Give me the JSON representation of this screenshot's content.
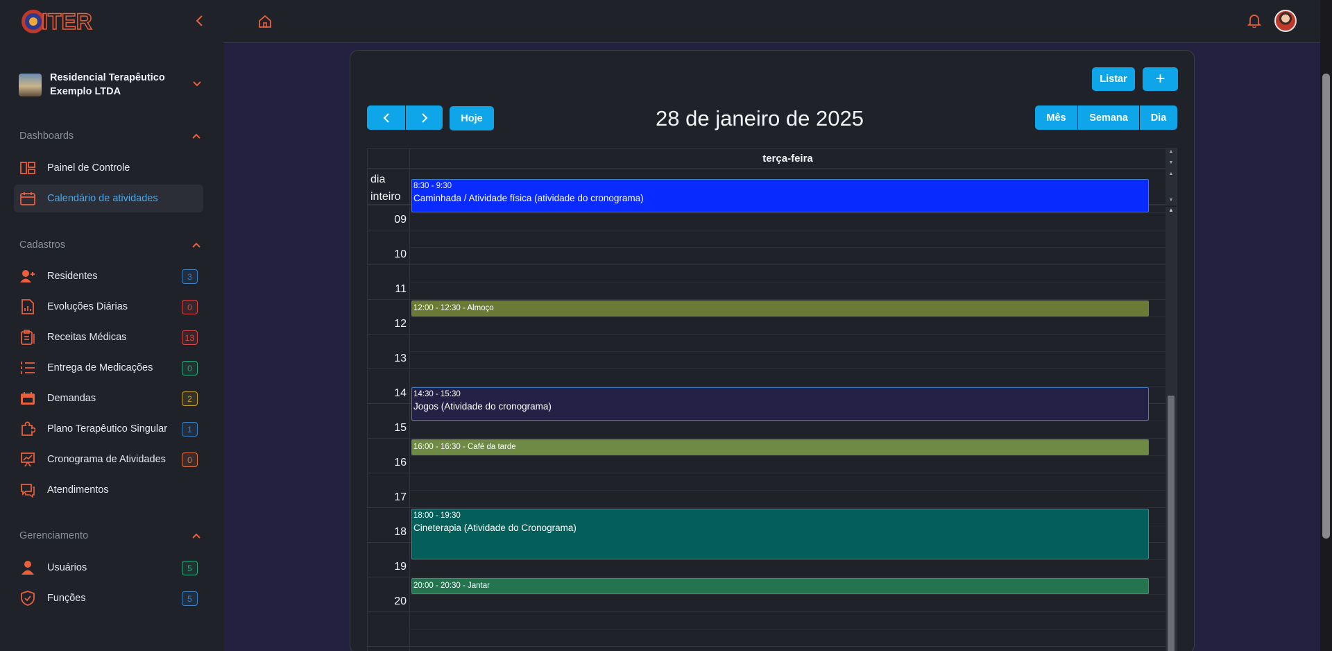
{
  "app": {
    "logo_text": "GITER"
  },
  "org": {
    "name": "Residencial Terapêutico Exemplo LTDA"
  },
  "sections": {
    "dashboards": "Dashboards",
    "cadastros": "Cadastros",
    "gerenciamento": "Gerenciamento"
  },
  "nav": {
    "painel": "Painel de Controle",
    "calendario": "Calendário de atividades",
    "residentes": {
      "label": "Residentes",
      "count": "3",
      "color": "#3b82c4"
    },
    "evolucoes": {
      "label": "Evoluções Diárias",
      "count": "0",
      "color": "#d94848"
    },
    "receitas": {
      "label": "Receitas Médicas",
      "count": "13",
      "color": "#d94848"
    },
    "entrega": {
      "label": "Entrega de Medicações",
      "count": "0",
      "color": "#2ea87a"
    },
    "demandas": {
      "label": "Demandas",
      "count": "2",
      "color": "#c9a227"
    },
    "plano": {
      "label": "Plano Terapêutico Singular",
      "count": "1",
      "color": "#3b82c4"
    },
    "cronograma": {
      "label": "Cronograma de Atividades",
      "count": "0",
      "color": "#e8733c"
    },
    "atendimentos": "Atendimentos",
    "usuarios": {
      "label": "Usuários",
      "count": "5",
      "color": "#2ea87a"
    },
    "funcoes": {
      "label": "Funções",
      "count": "5",
      "color": "#3b82c4"
    }
  },
  "toolbar": {
    "listar": "Listar",
    "add": "+",
    "hoje": "Hoje",
    "mes": "Mês",
    "semana": "Semana",
    "dia": "Dia",
    "title": "28 de janeiro de 2025"
  },
  "calendar": {
    "day_name": "terça-feira",
    "allday_label": "dia inteiro",
    "hours": [
      "09",
      "10",
      "11",
      "12",
      "13",
      "14",
      "15",
      "16",
      "17",
      "18",
      "19",
      "20"
    ],
    "events": [
      {
        "time": "8:30 - 9:30",
        "name": "Caminhada / Atividade física (atividade do cronograma)",
        "color": "#0a2bff"
      },
      {
        "time": "12:00 - 12:30 - Almoço",
        "name": "",
        "color": "#6b7a35"
      },
      {
        "time": "14:30 - 15:30",
        "name": "Jogos (Atividade do cronograma)",
        "color": "#242046"
      },
      {
        "time": "16:00 - 16:30 - Café da tarde",
        "name": "",
        "color": "#6e8a45"
      },
      {
        "time": "18:00 - 19:30",
        "name": "Cineterapia (Atividade do Cronograma)",
        "color": "#045e5a"
      },
      {
        "time": "20:00 - 20:30 - Jantar",
        "name": "",
        "color": "#24744f"
      }
    ]
  }
}
